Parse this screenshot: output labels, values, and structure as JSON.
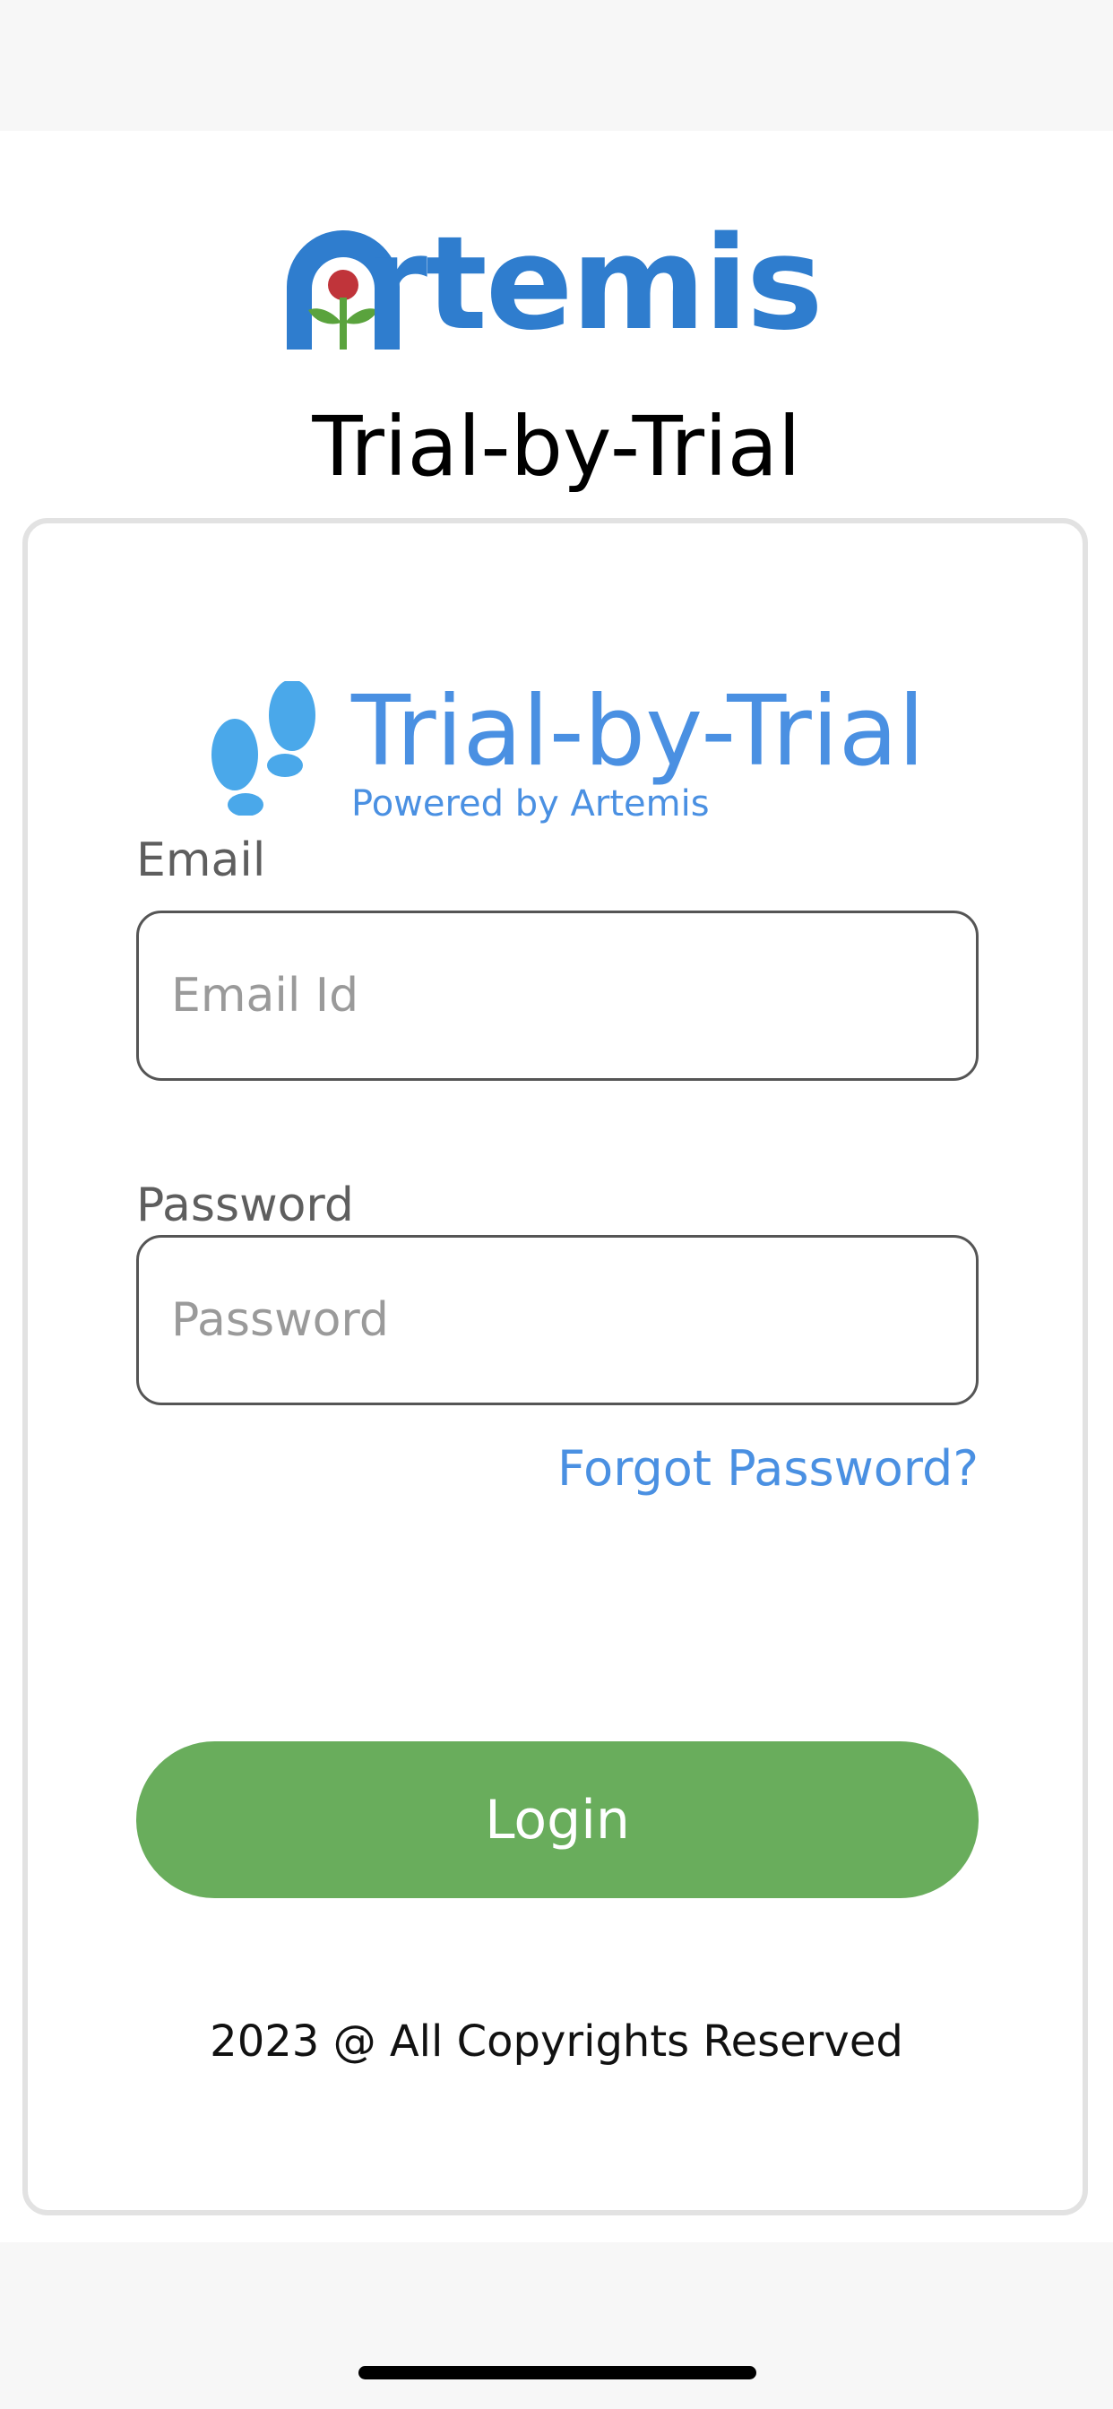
{
  "header": {
    "logo_text": "Artemis",
    "app_title": "Trial-by-Trial"
  },
  "login_card": {
    "brand_title": "Trial-by-Trial",
    "brand_subtitle": "Powered by Artemis",
    "brand_icon": "footprints-icon",
    "email": {
      "label": "Email",
      "placeholder": "Email Id",
      "value": ""
    },
    "password": {
      "label": "Password",
      "placeholder": "Password",
      "value": ""
    },
    "forgot_password_label": "Forgot Password?",
    "login_label": "Login",
    "copyright": "2023 @ All Copyrights Reserved"
  },
  "colors": {
    "brand_blue": "#4a90e2",
    "logo_blue": "#2f7dce",
    "login_green": "#69ad5c",
    "card_border": "#e2e2e2"
  }
}
